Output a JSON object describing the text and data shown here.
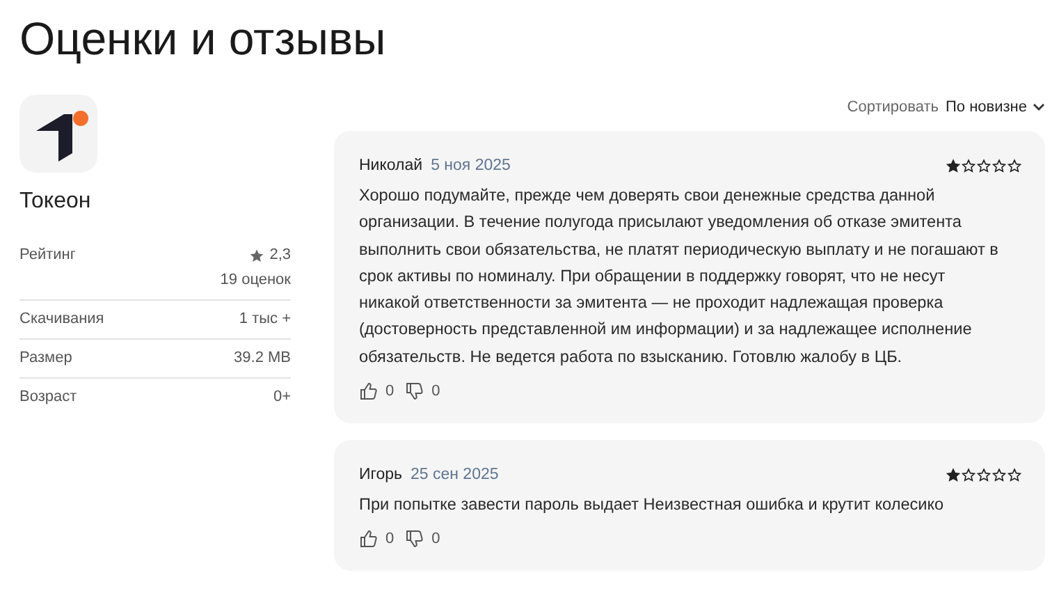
{
  "page_title": "Оценки и отзывы",
  "app": {
    "name": "Токеон"
  },
  "info": [
    {
      "label": "Рейтинг",
      "value": "2,3",
      "note": "19 оценок",
      "kind": "rating"
    },
    {
      "label": "Скачивания",
      "value": "1 тыс +",
      "kind": "plain"
    },
    {
      "label": "Размер",
      "value": "39.2 MB",
      "kind": "plain"
    },
    {
      "label": "Возраст",
      "value": "0+",
      "kind": "plain"
    }
  ],
  "sort": {
    "label": "Сортировать",
    "value": "По новизне"
  },
  "reviews": [
    {
      "author": "Николай",
      "date": "5 ноя 2025",
      "stars": 1,
      "text": "Хорошо подумайте, прежде чем доверять свои денежные средства данной организации. В течение полугода присылают уведомления об отказе эмитента выполнить свои обязательства, не платят периодическую выплату и не погашают в срок активы по номиналу. При обращении в поддержку говорят, что не несут никакой ответственности за эмитента — не проходит надлежащая проверка (достоверность представленной им информации) и за надлежащее исполнение обязательств. Не ведется работа по взысканию. Готовлю жалобу в ЦБ.",
      "likes": "0",
      "dislikes": "0"
    },
    {
      "author": "Игорь",
      "date": "25 сен 2025",
      "stars": 1,
      "text": "При попытке завести пароль выдает Неизвестная ошибка и крутит колесико",
      "likes": "0",
      "dislikes": "0"
    }
  ]
}
